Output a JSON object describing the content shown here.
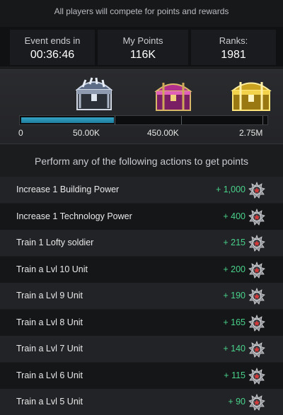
{
  "banner": {
    "text": "All players will compete for points and rewards"
  },
  "stats": {
    "event_ends": {
      "label": "Event ends in",
      "value": "00:36:46"
    },
    "my_points": {
      "label": "My Points",
      "value": "116K"
    },
    "rank": {
      "label": "Ranks:",
      "value": "1981"
    }
  },
  "rewards": {
    "progress_fraction": 0.38,
    "chest_icons": [
      "silver-chest-icon",
      "pink-chest-icon",
      "gold-chest-icon"
    ],
    "thresholds": [
      "0",
      "50.00K",
      "450.00K",
      "2.75M"
    ]
  },
  "actions": {
    "title": "Perform any of the following actions to get points",
    "point_icon": "medal-badge-icon",
    "items": [
      {
        "label": "Increase 1 Building Power",
        "points": "+ 1,000"
      },
      {
        "label": "Increase 1 Technology Power",
        "points": "+ 400"
      },
      {
        "label": "Train 1 Lofty soldier",
        "points": "+ 215"
      },
      {
        "label": "Train a Lvl 10 Unit",
        "points": "+ 200"
      },
      {
        "label": "Train a Lvl 9 Unit",
        "points": "+ 190"
      },
      {
        "label": "Train a Lvl 8 Unit",
        "points": "+ 165"
      },
      {
        "label": "Train a Lvl 7 Unit",
        "points": "+ 140"
      },
      {
        "label": "Train a Lvl 6 Unit",
        "points": "+ 115"
      },
      {
        "label": "Train a Lvl 5 Unit",
        "points": "+ 90"
      }
    ]
  }
}
